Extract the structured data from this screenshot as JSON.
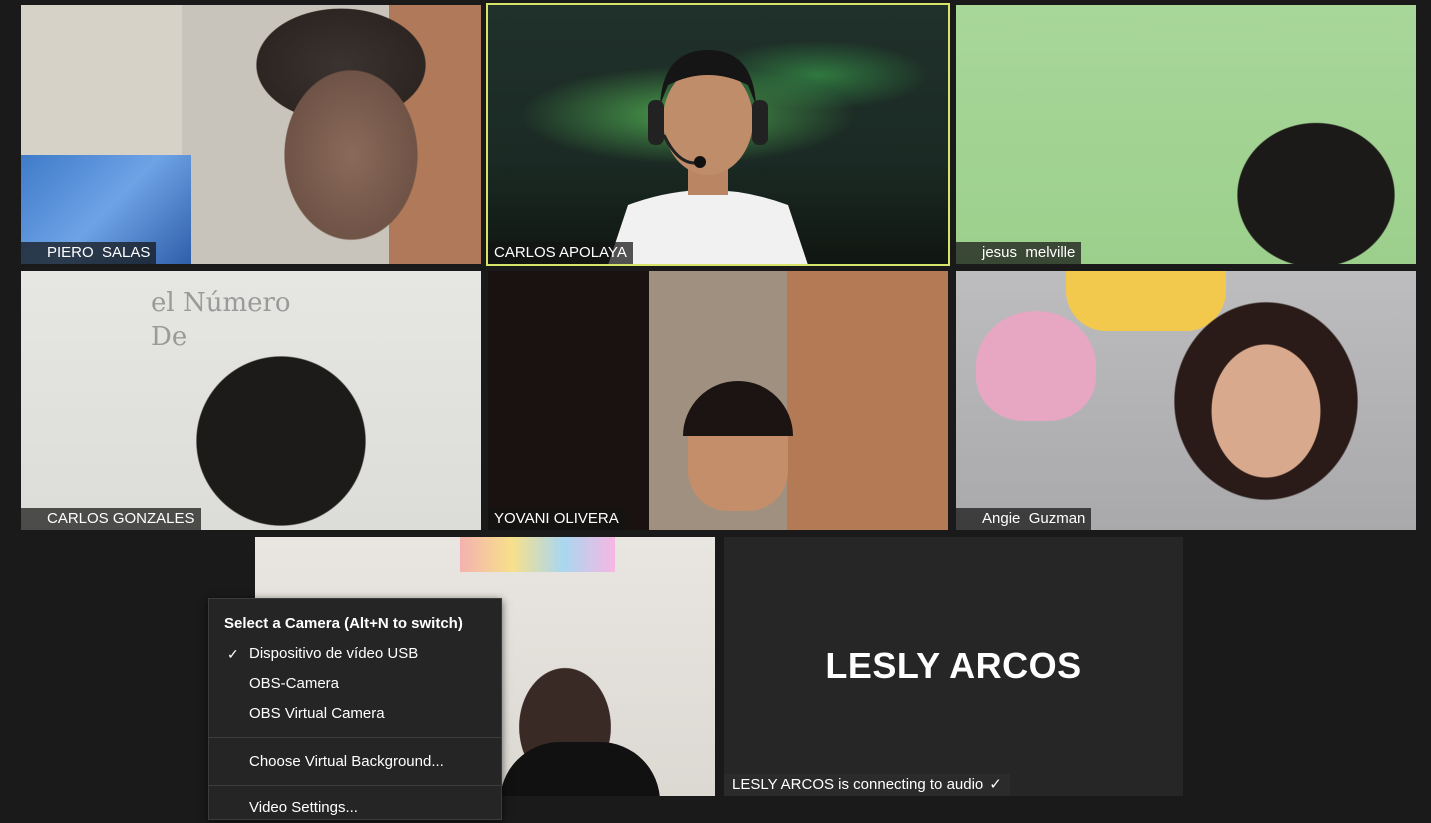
{
  "participants": [
    {
      "name": "PIERO  SALAS",
      "muted": true
    },
    {
      "name": "CARLOS APOLAYA",
      "muted": false,
      "active_speaker": true
    },
    {
      "name": "jesus  melville",
      "muted": true
    },
    {
      "name": "CARLOS GONZALES",
      "muted": true
    },
    {
      "name": "YOVANI OLIVERA",
      "muted": false
    },
    {
      "name": "Angie  Guzman",
      "muted": true
    }
  ],
  "board_text": [
    "el Número",
    "De"
  ],
  "avatar_tile": {
    "name": "LESLY ARCOS",
    "status": "LESLY ARCOS is connecting to audio",
    "status_icon": "check-icon"
  },
  "camera_menu": {
    "title": "Select a Camera (Alt+N to switch)",
    "items": [
      {
        "label": "Dispositivo de vídeo USB",
        "checked": true
      },
      {
        "label": "OBS-Camera",
        "checked": false
      },
      {
        "label": "OBS Virtual Camera",
        "checked": false
      }
    ],
    "virtual_background": "Choose Virtual Background...",
    "video_settings": "Video Settings..."
  },
  "colors": {
    "active_speaker_border": "#d6e56a",
    "muted_icon": "#e0453a",
    "background": "#1a1a1a"
  }
}
